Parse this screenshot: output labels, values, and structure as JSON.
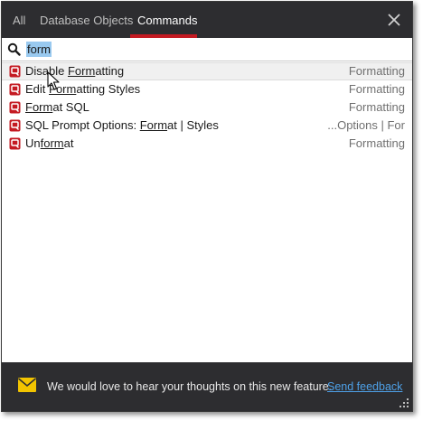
{
  "tabs": [
    {
      "label": "All",
      "active": false
    },
    {
      "label": "Database Objects",
      "active": false
    },
    {
      "label": "Commands",
      "active": true
    }
  ],
  "search": {
    "value": "form",
    "placeholder": ""
  },
  "results": [
    {
      "pre": "Disable ",
      "match": "Form",
      "post": "atting",
      "category": "Formatting",
      "selected": true
    },
    {
      "pre": "Edit ",
      "match": "Form",
      "post": "atting Styles",
      "category": "Formatting",
      "selected": false
    },
    {
      "pre": "",
      "match": "Form",
      "post": "at SQL",
      "category": "Formatting",
      "selected": false
    },
    {
      "pre": "SQL Prompt Options: ",
      "match": "Form",
      "post": "at | Styles",
      "category": "...Options | For",
      "selected": false
    },
    {
      "pre": "Un",
      "match": "form",
      "post": "at",
      "category": "Formatting",
      "selected": false
    }
  ],
  "feedback": {
    "text": "We would love to hear your thoughts on this new feature.",
    "link": "Send feedback"
  },
  "icons": {
    "close": "close-icon",
    "search": "search-icon",
    "result": "sql-prompt-icon",
    "feedback": "envelope-icon",
    "grip": "resize-grip-icon",
    "cursor": "mouse-pointer-icon"
  },
  "colors": {
    "tabbar_bg": "#2d2d30",
    "accent": "#c41a22",
    "selection": "#99c9ef",
    "link": "#4ea1e8",
    "mail": "#f2c400"
  }
}
